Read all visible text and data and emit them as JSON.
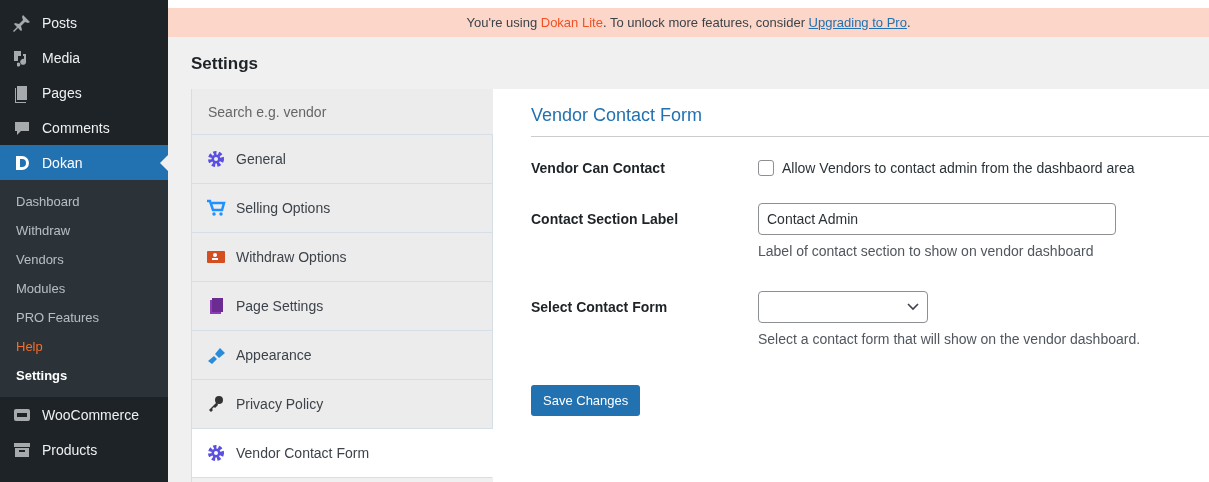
{
  "admin_menu": [
    {
      "label": "Posts",
      "selected": false
    },
    {
      "label": "Media",
      "selected": false
    },
    {
      "label": "Pages",
      "selected": false
    },
    {
      "label": "Comments",
      "selected": false
    },
    {
      "label": "Dokan",
      "selected": true,
      "children": [
        {
          "label": "Dashboard",
          "selected": false
        },
        {
          "label": "Withdraw",
          "selected": false
        },
        {
          "label": "Vendors",
          "selected": false
        },
        {
          "label": "Modules",
          "selected": false
        },
        {
          "label": "PRO Features",
          "selected": false
        },
        {
          "label": "Help",
          "selected": false,
          "color": "#f56e28"
        },
        {
          "label": "Settings",
          "selected": true
        }
      ]
    },
    {
      "label": "WooCommerce",
      "selected": false
    },
    {
      "label": "Products",
      "selected": false
    }
  ],
  "notice": {
    "before": "You're using ",
    "product": "Dokan Lite",
    "middle": ". To unlock more features, consider ",
    "link": "Upgrading to Pro",
    "after": "."
  },
  "page_title": "Settings",
  "settings_nav": {
    "search": {
      "placeholder": "Search e.g. vendor"
    },
    "items": [
      {
        "label": "General",
        "selected": false
      },
      {
        "label": "Selling Options",
        "selected": false
      },
      {
        "label": "Withdraw Options",
        "selected": false
      },
      {
        "label": "Page Settings",
        "selected": false
      },
      {
        "label": "Appearance",
        "selected": false
      },
      {
        "label": "Privacy Policy",
        "selected": false
      },
      {
        "label": "Vendor Contact Form",
        "selected": true
      }
    ]
  },
  "section": {
    "title": "Vendor Contact Form",
    "fields": [
      {
        "kind": "checkbox",
        "label": "Vendor Can Contact",
        "text": "Allow Vendors to contact admin from the dashbaord area",
        "checked": false
      },
      {
        "kind": "text",
        "label": "Contact Section Label",
        "value": "Contact Admin",
        "help": "Label of contact section to show on vendor dashboard"
      },
      {
        "kind": "select",
        "label": "Select Contact Form",
        "help": "Select a contact form that will show on the vendor dashboard."
      }
    ],
    "save_button": "Save Changes"
  }
}
